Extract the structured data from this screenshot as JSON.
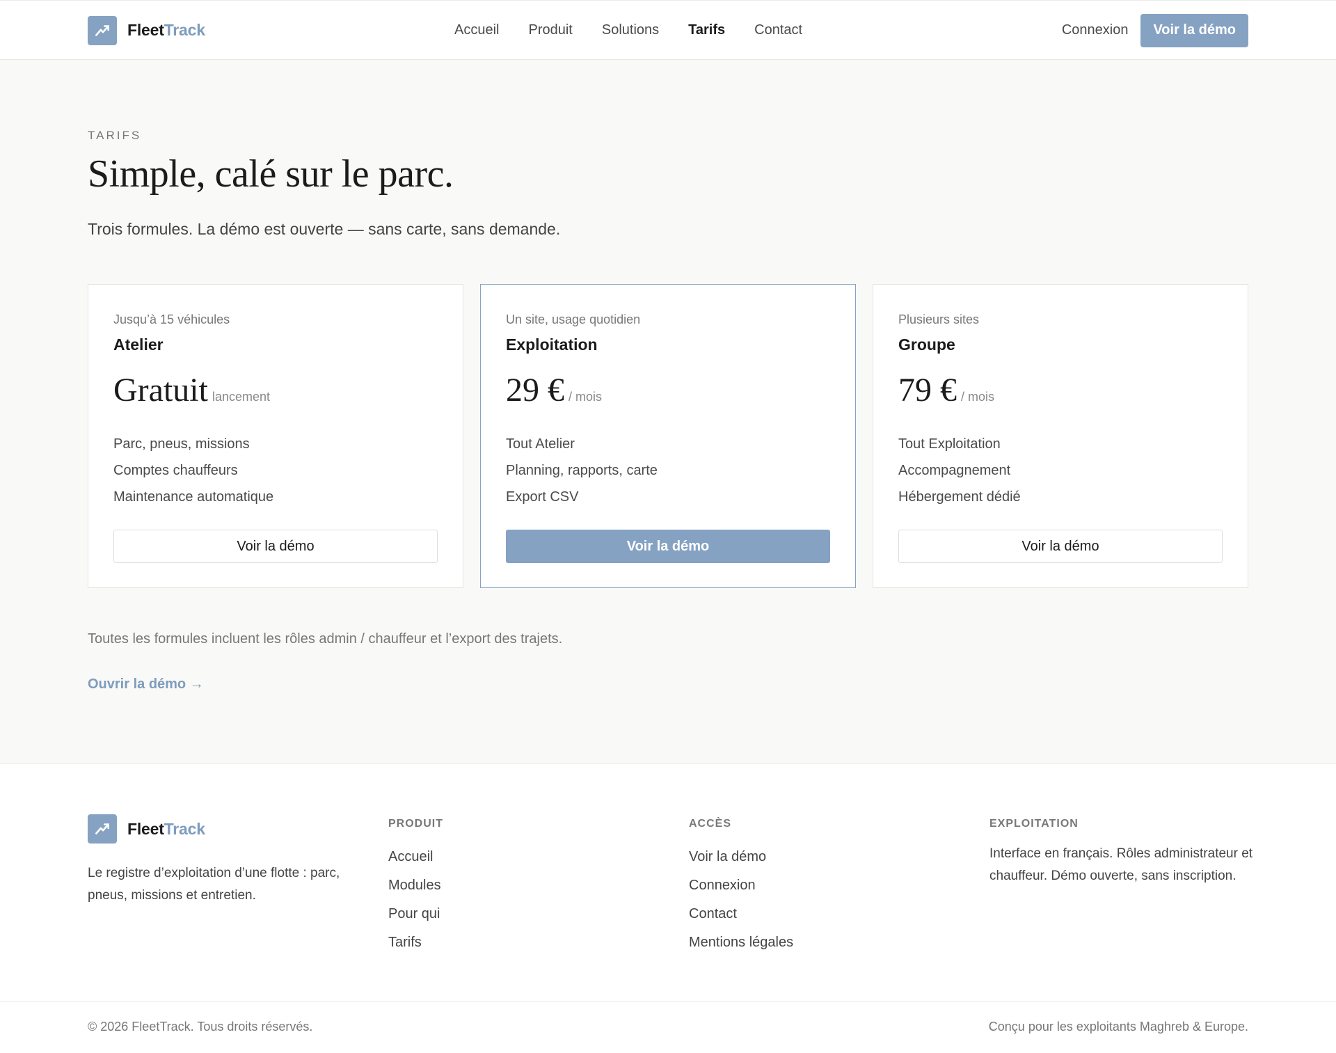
{
  "brand": {
    "name_part1": "Fleet",
    "name_part2": "Track",
    "logo_icon": "trend-up-icon"
  },
  "nav": {
    "items": [
      {
        "label": "Accueil",
        "active": false
      },
      {
        "label": "Produit",
        "active": false
      },
      {
        "label": "Solutions",
        "active": false
      },
      {
        "label": "Tarifs",
        "active": true
      },
      {
        "label": "Contact",
        "active": false
      }
    ],
    "login_label": "Connexion",
    "demo_label": "Voir la démo"
  },
  "hero": {
    "eyebrow": "TARIFS",
    "title": "Simple, calé sur le parc.",
    "subtitle": "Trois formules. La démo est ouverte — sans carte, sans demande."
  },
  "plans": [
    {
      "tag": "Jusqu’à 15 véhicules",
      "name": "Atelier",
      "price": "Gratuit",
      "unit": "lancement",
      "features": [
        "Parc, pneus, missions",
        "Comptes chauffeurs",
        "Maintenance automatique"
      ],
      "cta": "Voir la démo"
    },
    {
      "tag": "Un site, usage quotidien",
      "name": "Exploitation",
      "price": "29 €",
      "unit": "/ mois",
      "features": [
        "Tout Atelier",
        "Planning, rapports, carte",
        "Export CSV"
      ],
      "cta": "Voir la démo"
    },
    {
      "tag": "Plusieurs sites",
      "name": "Groupe",
      "price": "79 €",
      "unit": "/ mois",
      "features": [
        "Tout Exploitation",
        "Accompagnement",
        "Hébergement dédié"
      ],
      "cta": "Voir la démo"
    }
  ],
  "note": "Toutes les formules incluent les rôles admin / chauffeur et l’export des trajets.",
  "demo_link": "Ouvrir la démo →",
  "footer": {
    "description": "Le registre d’exploitation d’une flotte : parc, pneus, missions et entretien.",
    "columns": {
      "produit": {
        "title": "PRODUIT",
        "links": [
          "Accueil",
          "Modules",
          "Pour qui",
          "Tarifs"
        ]
      },
      "acces": {
        "title": "ACCÈS",
        "links": [
          "Voir la démo",
          "Connexion",
          "Contact",
          "Mentions légales"
        ]
      },
      "exploitation": {
        "title": "EXPLOITATION",
        "text": "Interface en français. Rôles administrateur et chauffeur. Démo ouverte, sans inscription."
      }
    },
    "copyright": "© 2026 FleetTrack. Tous droits réservés.",
    "tagline": "Conçu pour les exploitants Maghreb & Europe."
  },
  "colors": {
    "accent": "#86a2c2",
    "brand_accent_text": "#7e9cbd",
    "background": "#f9f9f7"
  }
}
